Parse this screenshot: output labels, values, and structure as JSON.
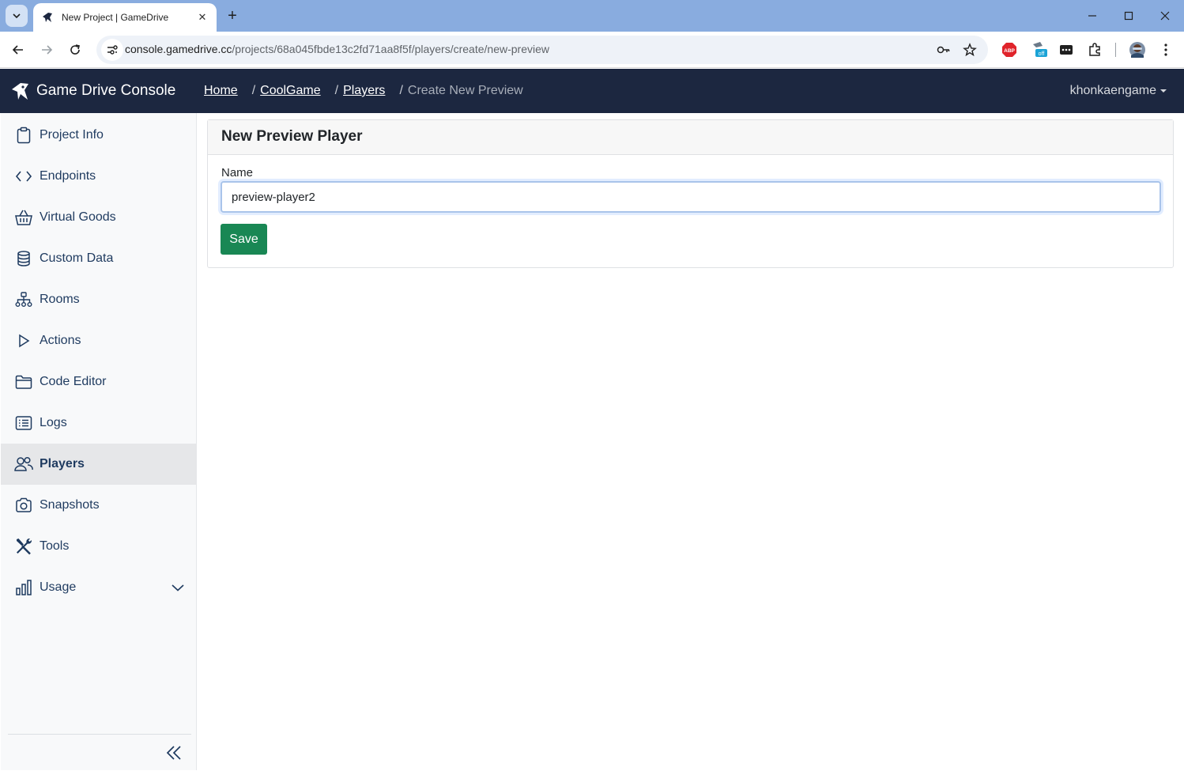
{
  "browser": {
    "tab_title": "New Project | GameDrive",
    "url_host": "console.gamedrive.cc",
    "url_path": "/projects/68a045fbde13c2fd71aa8f5f/players/create/new-preview",
    "extension_abp": "ABP",
    "extension_off": "off"
  },
  "app": {
    "brand": "Game Drive Console",
    "breadcrumbs": {
      "home": "Home",
      "project": "CoolGame",
      "section": "Players",
      "current": "Create New Preview",
      "separator": "/"
    },
    "user": "khonkaengame"
  },
  "sidebar": {
    "items": [
      {
        "label": "Project Info",
        "icon": "clipboard-icon"
      },
      {
        "label": "Endpoints",
        "icon": "code-icon"
      },
      {
        "label": "Virtual Goods",
        "icon": "basket-icon"
      },
      {
        "label": "Custom Data",
        "icon": "database-icon"
      },
      {
        "label": "Rooms",
        "icon": "network-icon"
      },
      {
        "label": "Actions",
        "icon": "play-icon"
      },
      {
        "label": "Code Editor",
        "icon": "folder-icon"
      },
      {
        "label": "Logs",
        "icon": "list-icon"
      },
      {
        "label": "Players",
        "icon": "people-icon"
      },
      {
        "label": "Snapshots",
        "icon": "camera-icon"
      },
      {
        "label": "Tools",
        "icon": "tools-icon"
      },
      {
        "label": "Usage",
        "icon": "bar-chart-icon"
      }
    ],
    "active": "Players"
  },
  "form": {
    "title": "New Preview Player",
    "name_label": "Name",
    "name_value": "preview-player2",
    "save_label": "Save"
  },
  "colors": {
    "tabstrip": "#89acdf",
    "navbar": "#1c2740",
    "save_button": "#198754",
    "link": "#1e3a5f"
  }
}
